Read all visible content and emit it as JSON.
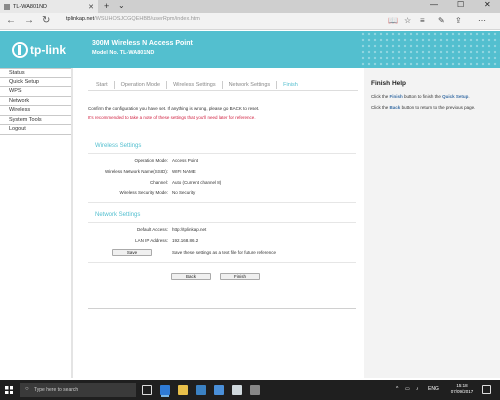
{
  "browser": {
    "tab_title": "TL-WA801ND",
    "url_host": "tplinkap.net",
    "url_path": "/WSUHOSJCGQEHBB/userRpm/index.htm",
    "tab_new": "+",
    "tab_close": "✕",
    "tab_more": "⌄",
    "win_min": "—",
    "win_max": "☐",
    "win_close": "✕",
    "back": "←",
    "forward": "→",
    "refresh": "↻",
    "reading_view": "📖",
    "favorite": "☆",
    "hub": "≡",
    "notes": "✎",
    "share": "⇪",
    "more": "⋯"
  },
  "header": {
    "logo_text": "tp-link",
    "product_name": "300M Wireless N Access Point",
    "model": "Model No. TL-WA801ND",
    "brand_color": "#53bfcf"
  },
  "menu": [
    "Status",
    "Quick Setup",
    "WPS",
    "Network",
    "Wireless",
    "System Tools",
    "Logout"
  ],
  "steps": [
    {
      "label": "Start",
      "active": false
    },
    {
      "label": "Operation Mode",
      "active": false
    },
    {
      "label": "Wireless Settings",
      "active": false
    },
    {
      "label": "Network Settings",
      "active": false
    },
    {
      "label": "Finish",
      "active": true
    }
  ],
  "messages": {
    "confirm": "Confirm the configuration you have set. If anything is wrong, please go BACK to reset.",
    "note": "It's recommended to take a note of these settings that you'll need later for reference."
  },
  "wireless": {
    "title": "Wireless Settings",
    "rows": [
      {
        "label": "Operation Mode:",
        "value": "Access Point"
      },
      {
        "label": "Wireless Network Name(SSID):",
        "value": "WIFI NAME"
      },
      {
        "label": "Channel:",
        "value": "Auto (Current channel 8)"
      },
      {
        "label": "Wireless Security Mode:",
        "value": "No Security"
      }
    ]
  },
  "network": {
    "title": "Network Settings",
    "rows": [
      {
        "label": "Default Access:",
        "value": "http://tplinkap.net"
      },
      {
        "label": "LAN IP Address:",
        "value": "192.168.86.2"
      }
    ],
    "save_label": "Save",
    "save_desc": "Save these settings as a text file for future reference"
  },
  "buttons": {
    "back": "Back",
    "finish": "Finish"
  },
  "help": {
    "title": "Finish Help",
    "line1_pre": "Click the",
    "line1_btn": "Finish",
    "line1_mid": "button to finish the",
    "line1_link": "Quick Setup",
    "line1_end": ".",
    "line2_pre": "Click the",
    "line2_btn": "Back",
    "line2_end": "button to return to the previous page."
  },
  "taskbar": {
    "search_placeholder": "Type here to search",
    "search_icon": "○",
    "tray_up": "^",
    "tray_lang": "ENG",
    "time": "15:18",
    "date": "07/09/2017",
    "icons": [
      "task-view-icon",
      "edge-icon",
      "file-explorer-icon",
      "store-icon",
      "mail-icon",
      "photos-icon",
      "settings-icon"
    ]
  }
}
